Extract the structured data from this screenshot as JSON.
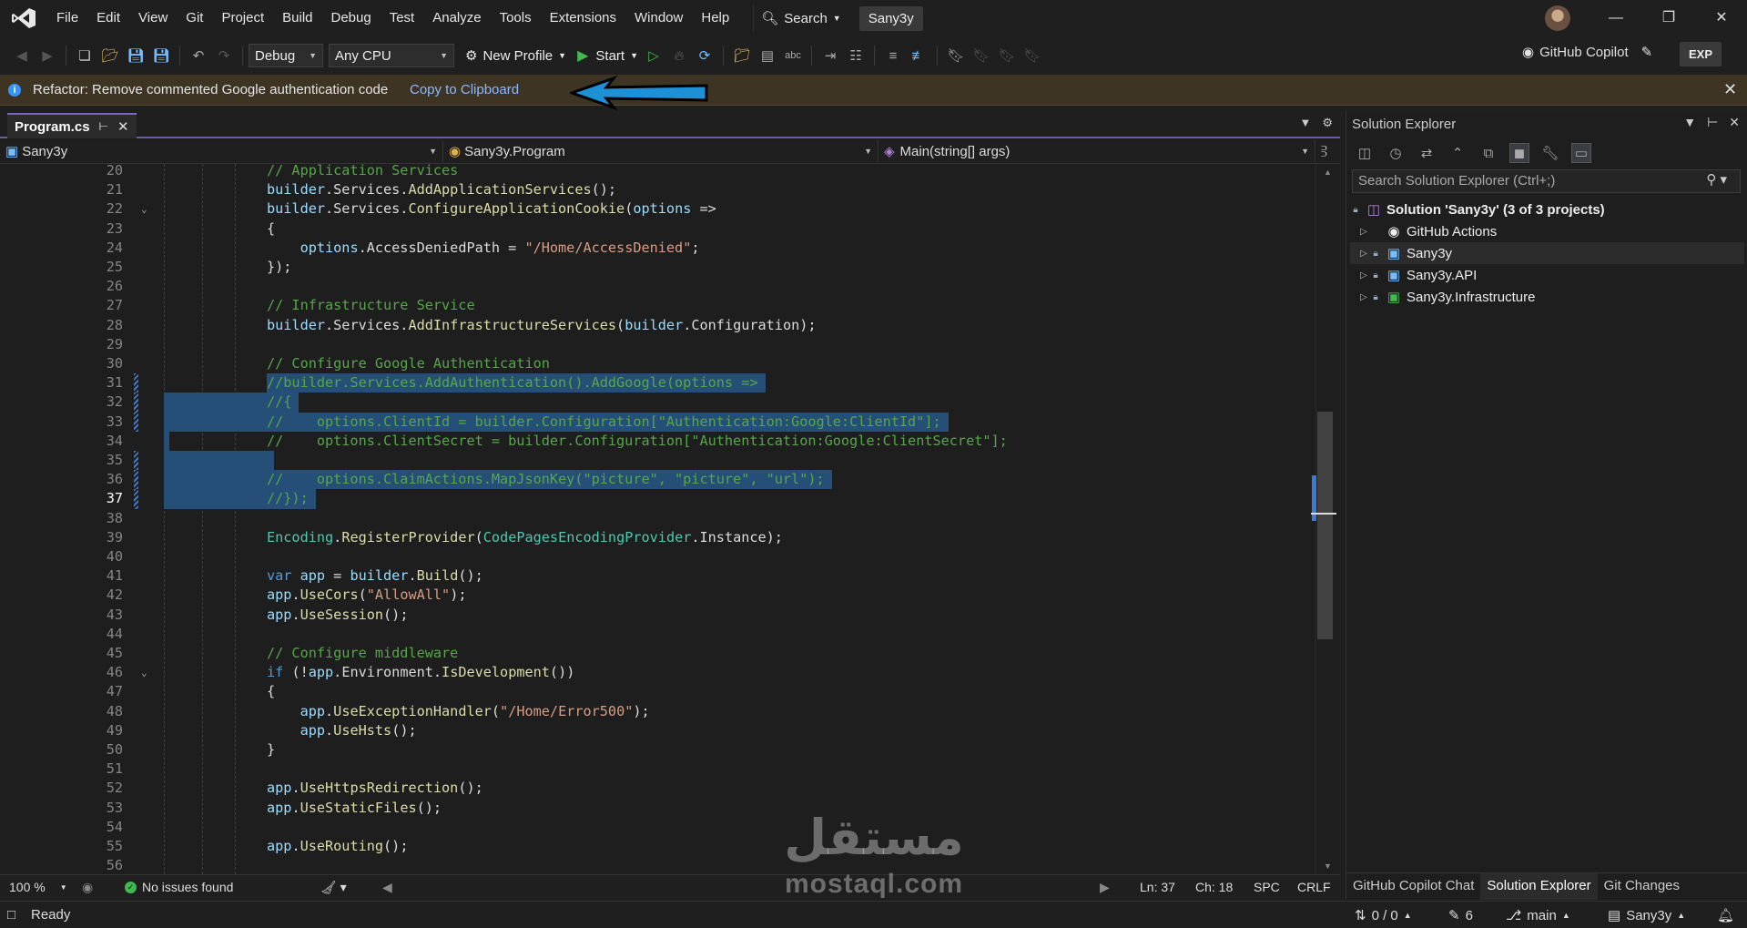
{
  "menubar": {
    "items": [
      "File",
      "Edit",
      "View",
      "Git",
      "Project",
      "Build",
      "Debug",
      "Test",
      "Analyze",
      "Tools",
      "Extensions",
      "Window",
      "Help"
    ],
    "search_label": "Search",
    "solution_badge": "Sany3y"
  },
  "toolbar": {
    "config": "Debug",
    "platform": "Any CPU",
    "profile": "New Profile",
    "start": "Start",
    "copilot": "GitHub Copilot",
    "exp": "EXP"
  },
  "infobar": {
    "message": "Refactor: Remove commented Google authentication code",
    "action": "Copy to Clipboard"
  },
  "editor": {
    "tab_label": "Program.cs",
    "nav": {
      "project": "Sany3y",
      "class": "Sany3y.Program",
      "member": "Main(string[] args)"
    },
    "lines": [
      {
        "n": "20",
        "t": "// Application Services"
      },
      {
        "n": "21",
        "t": "builder.Services.AddApplicationServices();"
      },
      {
        "n": "22",
        "t": "builder.Services.ConfigureApplicationCookie(options =>"
      },
      {
        "n": "23",
        "t": "{"
      },
      {
        "n": "24",
        "t": "    options.AccessDeniedPath = \"/Home/AccessDenied\";"
      },
      {
        "n": "25",
        "t": "});"
      },
      {
        "n": "26",
        "t": ""
      },
      {
        "n": "27",
        "t": "// Infrastructure Service"
      },
      {
        "n": "28",
        "t": "builder.Services.AddInfrastructureServices(builder.Configuration);"
      },
      {
        "n": "29",
        "t": ""
      },
      {
        "n": "30",
        "t": "// Configure Google Authentication"
      },
      {
        "n": "31",
        "t": "//builder.Services.AddAuthentication().AddGoogle(options =>"
      },
      {
        "n": "32",
        "t": "//{"
      },
      {
        "n": "33",
        "t": "//    options.ClientId = builder.Configuration[\"Authentication:Google:ClientId\"];"
      },
      {
        "n": "34",
        "t": "//    options.ClientSecret = builder.Configuration[\"Authentication:Google:ClientSecret\"];"
      },
      {
        "n": "35",
        "t": ""
      },
      {
        "n": "36",
        "t": "//    options.ClaimActions.MapJsonKey(\"picture\", \"picture\", \"url\");"
      },
      {
        "n": "37",
        "t": "//});"
      },
      {
        "n": "38",
        "t": ""
      },
      {
        "n": "39",
        "t": "Encoding.RegisterProvider(CodePagesEncodingProvider.Instance);"
      },
      {
        "n": "40",
        "t": ""
      },
      {
        "n": "41",
        "t": "var app = builder.Build();"
      },
      {
        "n": "42",
        "t": "app.UseCors(\"AllowAll\");"
      },
      {
        "n": "43",
        "t": "app.UseSession();"
      },
      {
        "n": "44",
        "t": ""
      },
      {
        "n": "45",
        "t": "// Configure middleware"
      },
      {
        "n": "46",
        "t": "if (!app.Environment.IsDevelopment())"
      },
      {
        "n": "47",
        "t": "{"
      },
      {
        "n": "48",
        "t": "    app.UseExceptionHandler(\"/Home/Error500\");"
      },
      {
        "n": "49",
        "t": "    app.UseHsts();"
      },
      {
        "n": "50",
        "t": "}"
      },
      {
        "n": "51",
        "t": ""
      },
      {
        "n": "52",
        "t": "app.UseHttpsRedirection();"
      },
      {
        "n": "53",
        "t": "app.UseStaticFiles();"
      },
      {
        "n": "54",
        "t": ""
      },
      {
        "n": "55",
        "t": "app.UseRouting();"
      },
      {
        "n": "56",
        "t": ""
      }
    ],
    "status": {
      "zoom": "100 %",
      "issues": "No issues found",
      "line": "Ln: 37",
      "col": "Ch: 18",
      "spacing": "SPC",
      "eol": "CRLF"
    }
  },
  "solution_explorer": {
    "title": "Solution Explorer",
    "search_placeholder": "Search Solution Explorer (Ctrl+;)",
    "root": "Solution 'Sany3y' (3 of 3 projects)",
    "items": [
      "GitHub Actions",
      "Sany3y",
      "Sany3y.API",
      "Sany3y.Infrastructure"
    ],
    "tabs": [
      "GitHub Copilot Chat",
      "Solution Explorer",
      "Git Changes"
    ]
  },
  "statusbar": {
    "ready": "Ready",
    "sync": "0 / 0",
    "changes": "6",
    "branch": "main",
    "repo": "Sany3y"
  },
  "watermark": {
    "arabic": "مستقل",
    "latin": "mostaql.com"
  }
}
